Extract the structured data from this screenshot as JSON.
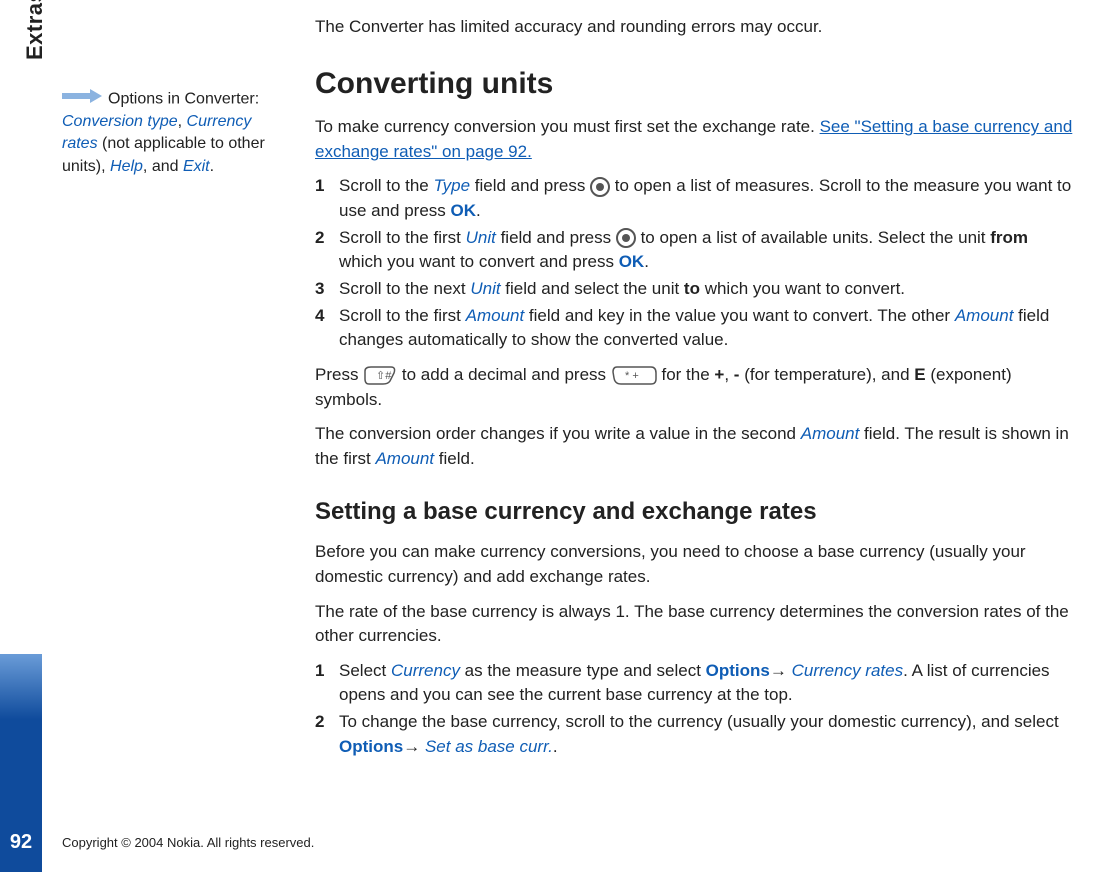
{
  "chapter": "Extras",
  "pageNumber": "92",
  "copyright": "Copyright © 2004 Nokia. All rights reserved.",
  "sidebar": {
    "lead": "Options in Converter:",
    "opt1": "Conversion type",
    "comma1": ", ",
    "opt2": "Currency rates",
    "paren": " (not applicable to other units), ",
    "opt3": "Help",
    "and": ", and ",
    "opt4": "Exit",
    "period": "."
  },
  "main": {
    "intro": "The Converter has limited accuracy and rounding errors may occur.",
    "h1": "Converting units",
    "p1a": "To make currency conversion you must first set the exchange rate. ",
    "p1link": "See \"Setting a base currency and exchange rates\" on page 92.",
    "steps1": {
      "s1a": "Scroll to the ",
      "s1b": "Type",
      "s1c": " field and press ",
      "s1d": " to open a list of measures. Scroll to the measure you want to use and press ",
      "s1e": "OK",
      "s1f": ".",
      "s2a": "Scroll to the first ",
      "s2b": "Unit",
      "s2c": " field and press ",
      "s2d": " to open a list of available units. Select the unit ",
      "s2e": "from",
      "s2f": " which you want to convert and press ",
      "s2g": "OK",
      "s2h": ".",
      "s3a": "Scroll to the next ",
      "s3b": "Unit",
      "s3c": " field and select the unit ",
      "s3d": "to",
      "s3e": " which you want to convert.",
      "s4a": "Scroll to the first ",
      "s4b": "Amount",
      "s4c": " field and key in the value you want to convert. The other ",
      "s4d": "Amount",
      "s4e": " field changes automatically to show the converted value."
    },
    "pressA": "Press ",
    "pressB": " to add a decimal and press ",
    "pressC": " for the ",
    "plus": "+",
    "pressD": ", ",
    "minus": "-",
    "pressE": " (for temperature), and ",
    "eSym": "E",
    "pressF": " (exponent) symbols.",
    "orderA": "The conversion order changes if you write a value in the second ",
    "orderB": "Amount",
    "orderC": " field. The result is shown in the first ",
    "orderD": "Amount",
    "orderE": " field.",
    "h2": "Setting a base currency and exchange rates",
    "p2": "Before you can make currency conversions, you need to choose a base currency (usually your domestic currency) and add exchange rates.",
    "p3": "The rate of the base currency is always 1. The base currency determines the conversion rates of the other currencies.",
    "steps2": {
      "s1a": "Select ",
      "s1b": "Currency",
      "s1c": " as the measure type and select ",
      "s1d": "Options",
      "s1e": "→ ",
      "s1f": "Currency rates",
      "s1g": ". A list of currencies opens and you can see the current base currency at the top.",
      "s2a": "To change the base currency, scroll to the currency (usually your domestic currency), and select ",
      "s2b": "Options",
      "s2c": "→ ",
      "s2d": "Set as base curr.",
      "s2e": "."
    }
  },
  "nums": {
    "n1": "1",
    "n2": "2",
    "n3": "3",
    "n4": "4"
  }
}
